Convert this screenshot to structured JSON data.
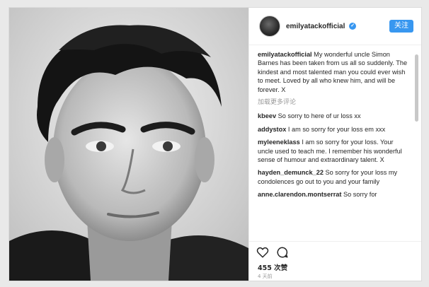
{
  "post": {
    "username": "emilyatackofficial",
    "follow_label": "关注",
    "caption_user": "emilyatackofficial",
    "caption_text": "My wonderful uncle Simon Barnes has been taken from us all so suddenly. The kindest and most talented man you could ever wish to meet. Loved by all who knew him, and will be forever. X",
    "load_more": "加载更多评论",
    "comments": [
      {
        "user": "kbeev",
        "text": "So sorry to here of ur loss xx"
      },
      {
        "user": "addystox",
        "text": "I am so sorry for your loss em xxx"
      },
      {
        "user": "myleeneklass",
        "text": "I am so sorry for your loss. Your uncle used to teach me. I remember his wonderful sense of humour and extraordinary talent. X"
      },
      {
        "user": "hayden_demunck_22",
        "text": "So sorry for your loss my condolences go out to you and your family"
      },
      {
        "user": "anne.clarendon.montserrat",
        "text": "So sorry for"
      }
    ],
    "likes": "455 次赞",
    "timestamp": "4 天前"
  },
  "icons": {
    "verified": "verified-badge-icon",
    "like": "heart-icon",
    "comment": "comment-bubble-icon"
  },
  "colors": {
    "accent": "#3897f0",
    "muted": "#999999"
  }
}
